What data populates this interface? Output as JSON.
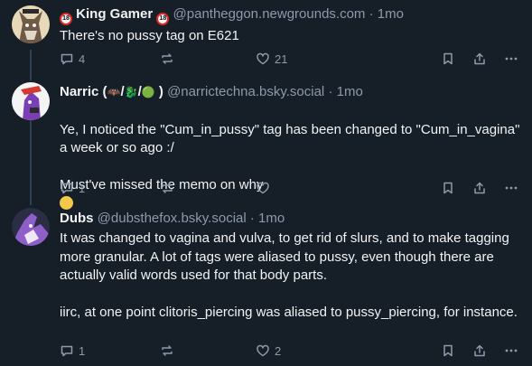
{
  "posts": [
    {
      "display_name": "King Gamer",
      "name_prefix_badge": "18",
      "name_suffix_badge": "18",
      "handle": "@pantheggon.newgrounds.com",
      "separator": "·",
      "time": "1mo",
      "body": "There's no pussy tag on E621",
      "reply_count": "4",
      "repost_count": "",
      "like_count": "21"
    },
    {
      "display_name": "Narric (",
      "name_emojis": [
        "🦇",
        "/",
        "🐉",
        "/",
        "🟢"
      ],
      "name_suffix": ")",
      "handle": "@narrictechna.bsky.social",
      "separator": "·",
      "time": "1mo",
      "body": "Ye, I noticed the \"Cum_in_pussy\" tag has been changed to \"Cum_in_vagina\" a week or so ago :/\n\nMust've missed the memo on why",
      "reply_count": "1",
      "repost_count": "",
      "like_count": ""
    },
    {
      "display_name": "Dubs",
      "handle": "@dubsthefox.bsky.social",
      "separator": "·",
      "time": "1mo",
      "body": "It was changed to vagina and vulva, to get rid of slurs, and to make tagging more granular. A lot of tags were aliased to pussy, even though there are actually valid words used for that body parts.\n\niirc, at one point clitoris_piercing was aliased to pussy_piercing, for instance.",
      "reply_count": "1",
      "repost_count": "",
      "like_count": "2"
    }
  ],
  "icons": [
    "reply-icon",
    "repost-icon",
    "like-icon",
    "bookmark-icon",
    "share-icon",
    "more-icon"
  ],
  "colors": {
    "background": "#161e27",
    "muted": "#8c9aab",
    "text": "#f1f3f5",
    "thread_line": "#2e4052"
  }
}
